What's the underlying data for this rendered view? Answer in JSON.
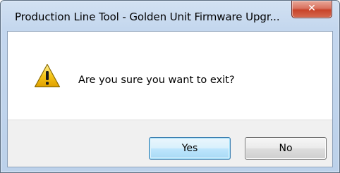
{
  "window": {
    "title": "Production Line Tool - Golden Unit Firmware Upgr...",
    "close_glyph": "✕"
  },
  "dialog": {
    "icon": "warning-icon",
    "message": "Are you sure you want to exit?"
  },
  "buttons": {
    "yes_label": "Yes",
    "no_label": "No"
  },
  "colors": {
    "accent": "#3c7fb1",
    "warning_fill": "#f5c518",
    "close_button": "#c8432a"
  }
}
